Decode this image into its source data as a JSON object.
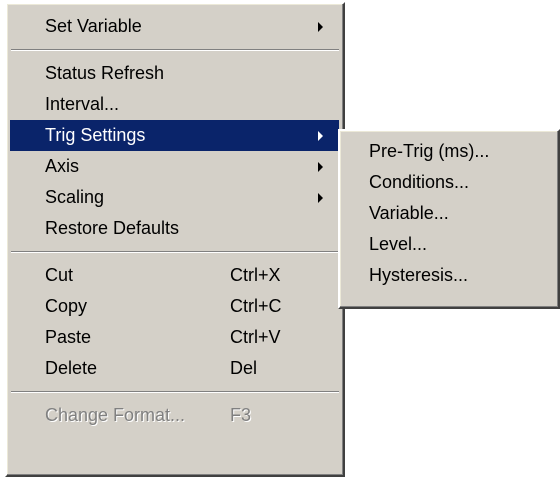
{
  "main_menu": {
    "set_variable": "Set Variable",
    "status_refresh": "Status Refresh",
    "interval": "Interval...",
    "trig_settings": "Trig Settings",
    "axis": "Axis",
    "scaling": "Scaling",
    "restore_defaults": "Restore Defaults",
    "cut": "Cut",
    "cut_shortcut": "Ctrl+X",
    "copy": "Copy",
    "copy_shortcut": "Ctrl+C",
    "paste": "Paste",
    "paste_shortcut": "Ctrl+V",
    "delete": "Delete",
    "delete_shortcut": "Del",
    "change_format": "Change Format...",
    "change_format_shortcut": "F3"
  },
  "submenu": {
    "pre_trig": "Pre-Trig (ms)...",
    "conditions": "Conditions...",
    "variable": "Variable...",
    "level": "Level...",
    "hysteresis": "Hysteresis..."
  },
  "colors": {
    "menu_bg": "#d4d0c8",
    "highlight": "#0a246a",
    "disabled_text": "#808080"
  }
}
